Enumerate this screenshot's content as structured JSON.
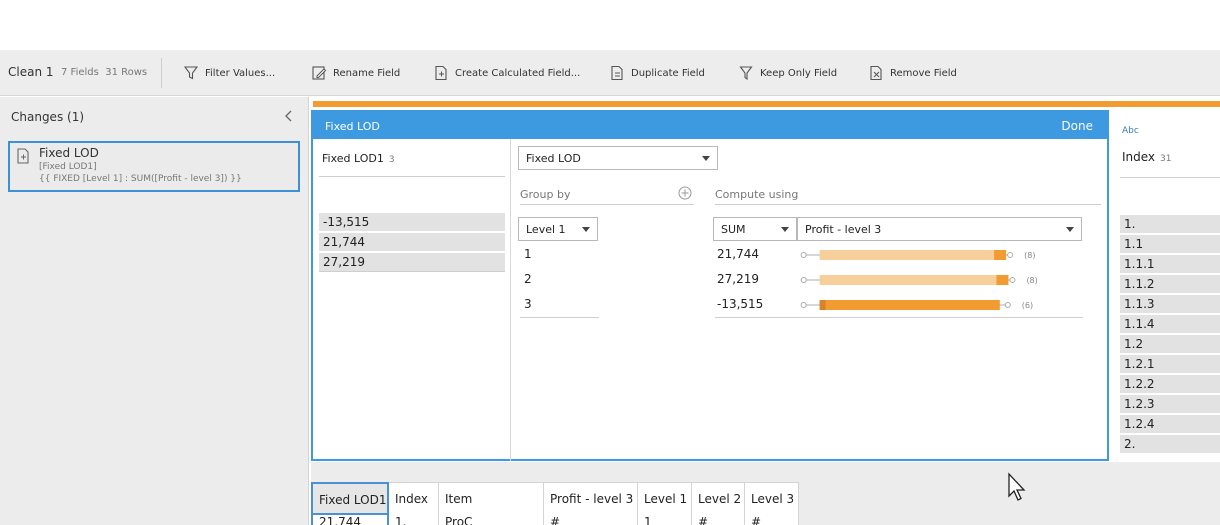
{
  "toolbar": {
    "step_name": "Clean 1",
    "fields": "7 Fields",
    "rows": "31 Rows",
    "actions": [
      {
        "label": "Filter Values...",
        "icon": "filter-icon"
      },
      {
        "label": "Rename Field",
        "icon": "rename-icon"
      },
      {
        "label": "Create Calculated Field...",
        "icon": "calculated-field-icon"
      },
      {
        "label": "Duplicate Field",
        "icon": "duplicate-icon"
      },
      {
        "label": "Keep Only Field",
        "icon": "keep-only-icon"
      },
      {
        "label": "Remove Field",
        "icon": "remove-icon"
      }
    ]
  },
  "changes": {
    "title": "Changes (1)",
    "item": {
      "name": "Fixed LOD",
      "field": "[Fixed LOD1]",
      "formula": "{{ FIXED [Level 1] : SUM([Profit - level 3]) }}"
    }
  },
  "editor": {
    "title": "Fixed LOD",
    "done_label": "Done",
    "field_name": "Fixed LOD1",
    "field_count": "3",
    "values": [
      "-13,515",
      "21,744",
      "27,219"
    ],
    "calc_type": "Fixed LOD",
    "group_by_label": "Group by",
    "group_field": "Level 1",
    "groups": [
      "1",
      "2",
      "3"
    ],
    "compute_label": "Compute using",
    "aggregate": "SUM",
    "measure": "Profit - level 3",
    "results": [
      {
        "value": "21,744",
        "count": "(8)",
        "min": 0.02,
        "max": 0.91
      },
      {
        "value": "27,219",
        "count": "(8)",
        "min": 0.02,
        "max": 0.92
      },
      {
        "value": "-13,515",
        "count": "(6)",
        "min": 0.02,
        "max": 0.9
      }
    ]
  },
  "index_column": {
    "type_label": "Abc",
    "title": "Index",
    "count": "31",
    "values": [
      "1.",
      "1.1",
      "1.1.1",
      "1.1.2",
      "1.1.3",
      "1.1.4",
      "1.2",
      "1.2.1",
      "1.2.2",
      "1.2.3",
      "1.2.4",
      "2."
    ]
  },
  "grid": {
    "columns": [
      "Fixed LOD1",
      "Index",
      "Item",
      "Profit - level 3",
      "Level 1",
      "Level 2",
      "Level 3"
    ],
    "first_row": [
      "21,744",
      "1.",
      "ProC",
      "#",
      "1",
      "#",
      "#"
    ]
  },
  "colors": {
    "accent_blue": "#3d9ae0",
    "orange": "#f29b30",
    "light_orange": "#f7cf9b"
  }
}
